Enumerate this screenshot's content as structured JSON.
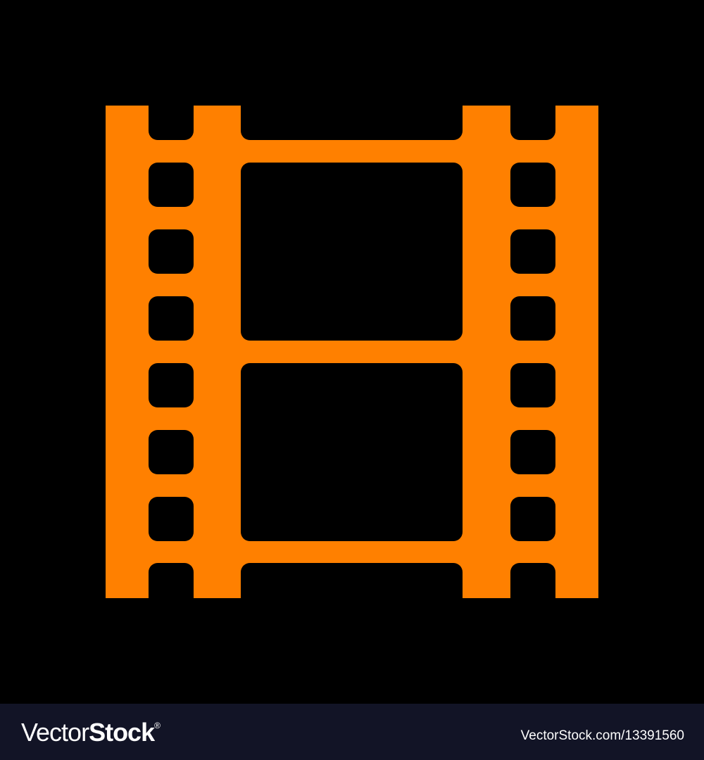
{
  "artwork": {
    "subject": "film-strip-icon",
    "colors": {
      "icon": "#ff8000",
      "background": "#000000",
      "footer": "#121426"
    }
  },
  "footer": {
    "logo_light": "Vector",
    "logo_bold": "Stock",
    "logo_mark": "®",
    "image_id": "VectorStock.com/13391560"
  }
}
